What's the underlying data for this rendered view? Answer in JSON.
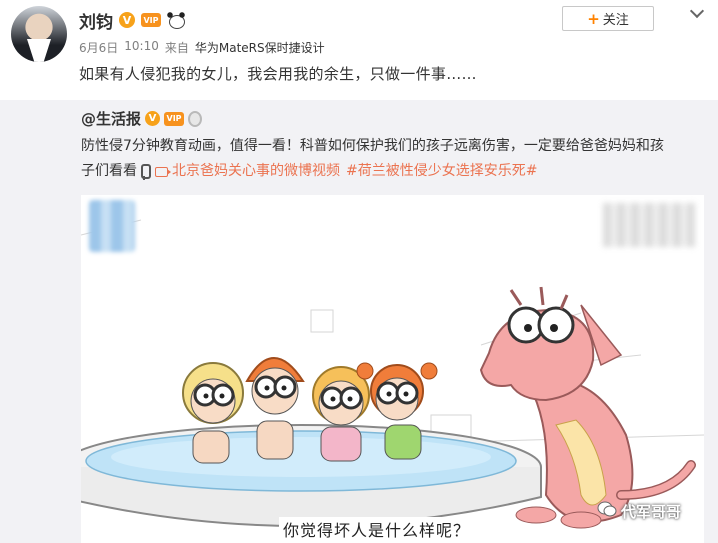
{
  "post": {
    "author_name": "刘钧",
    "verified_mark": "V",
    "date": "6月6日",
    "time": "10:10",
    "source_prefix": "来自",
    "source": "华为MateRS保时捷设计",
    "text": "如果有人侵犯我的女儿，我会用我的余生，只做一件事……",
    "follow_label": "关注",
    "follow_plus": "+"
  },
  "repost": {
    "author": "@生活报",
    "verified_mark": "V",
    "text_line1": "防性侵7分钟教育动画，值得一看！科普如何保护我们的孩子远离伤害，一定要给爸爸妈妈和孩",
    "text_line2": "子们看看",
    "video_link": "北京爸妈关心事的微博视频",
    "topic": "#荷兰被性侵少女选择安乐死#"
  },
  "video": {
    "subtitle": "你觉得坏人是什么样呢？",
    "watermark": "代军哥哥"
  },
  "colors": {
    "accent_orange": "#ff8200",
    "link": "#eb7350",
    "repost_bg": "#f2f2f5",
    "pool_water": "#bfe3f7",
    "dragon_pink": "#f4a7a6"
  }
}
